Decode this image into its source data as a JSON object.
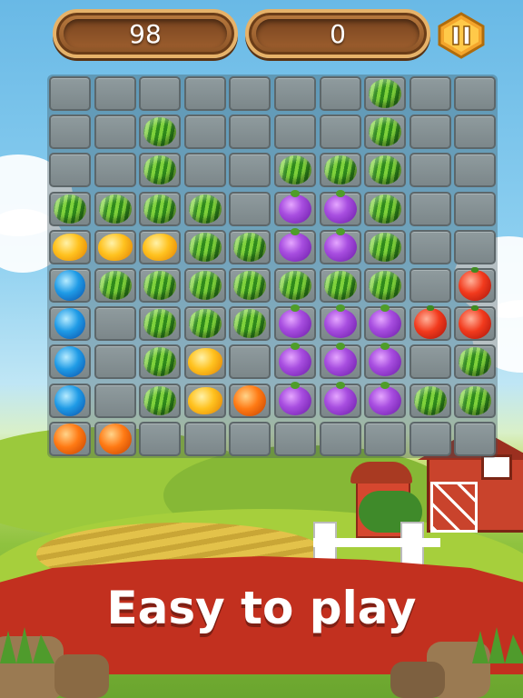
{
  "hud": {
    "moves": "98",
    "score": "0",
    "pause_icon": "pause-icon"
  },
  "banner": {
    "text": "Easy to play"
  },
  "colors": {
    "banner_red": "#c2301f",
    "wood": "#8a5226",
    "pause_gold": "#f4a52c"
  },
  "board": {
    "cols": 10,
    "rows": 10,
    "grid": [
      [
        null,
        null,
        null,
        null,
        null,
        null,
        null,
        "watermelon",
        null,
        null
      ],
      [
        null,
        null,
        "watermelon",
        null,
        null,
        null,
        null,
        "watermelon",
        null,
        null
      ],
      [
        null,
        null,
        "watermelon",
        null,
        null,
        "watermelon",
        "watermelon",
        "watermelon",
        null,
        null
      ],
      [
        "watermelon",
        "watermelon",
        "watermelon",
        "watermelon",
        null,
        "plum",
        "plum",
        "watermelon",
        null,
        null
      ],
      [
        "mango",
        "mango",
        "mango",
        "watermelon",
        "watermelon",
        "plum",
        "plum",
        "watermelon",
        null,
        null
      ],
      [
        "blueberry",
        "watermelon",
        "watermelon",
        "watermelon",
        "watermelon",
        "watermelon",
        "watermelon",
        "watermelon",
        null,
        "tomato"
      ],
      [
        "blueberry",
        null,
        "watermelon",
        "watermelon",
        "watermelon",
        "plum",
        "plum",
        "plum",
        "tomato",
        "tomato"
      ],
      [
        "blueberry",
        null,
        "watermelon",
        "mango",
        null,
        "plum",
        "plum",
        "plum",
        null,
        "watermelon"
      ],
      [
        "blueberry",
        null,
        "watermelon",
        "mango",
        "orange",
        "plum",
        "plum",
        "plum",
        "watermelon",
        "watermelon"
      ],
      [
        "orange",
        "orange",
        null,
        null,
        null,
        null,
        null,
        null,
        null,
        null
      ]
    ]
  }
}
